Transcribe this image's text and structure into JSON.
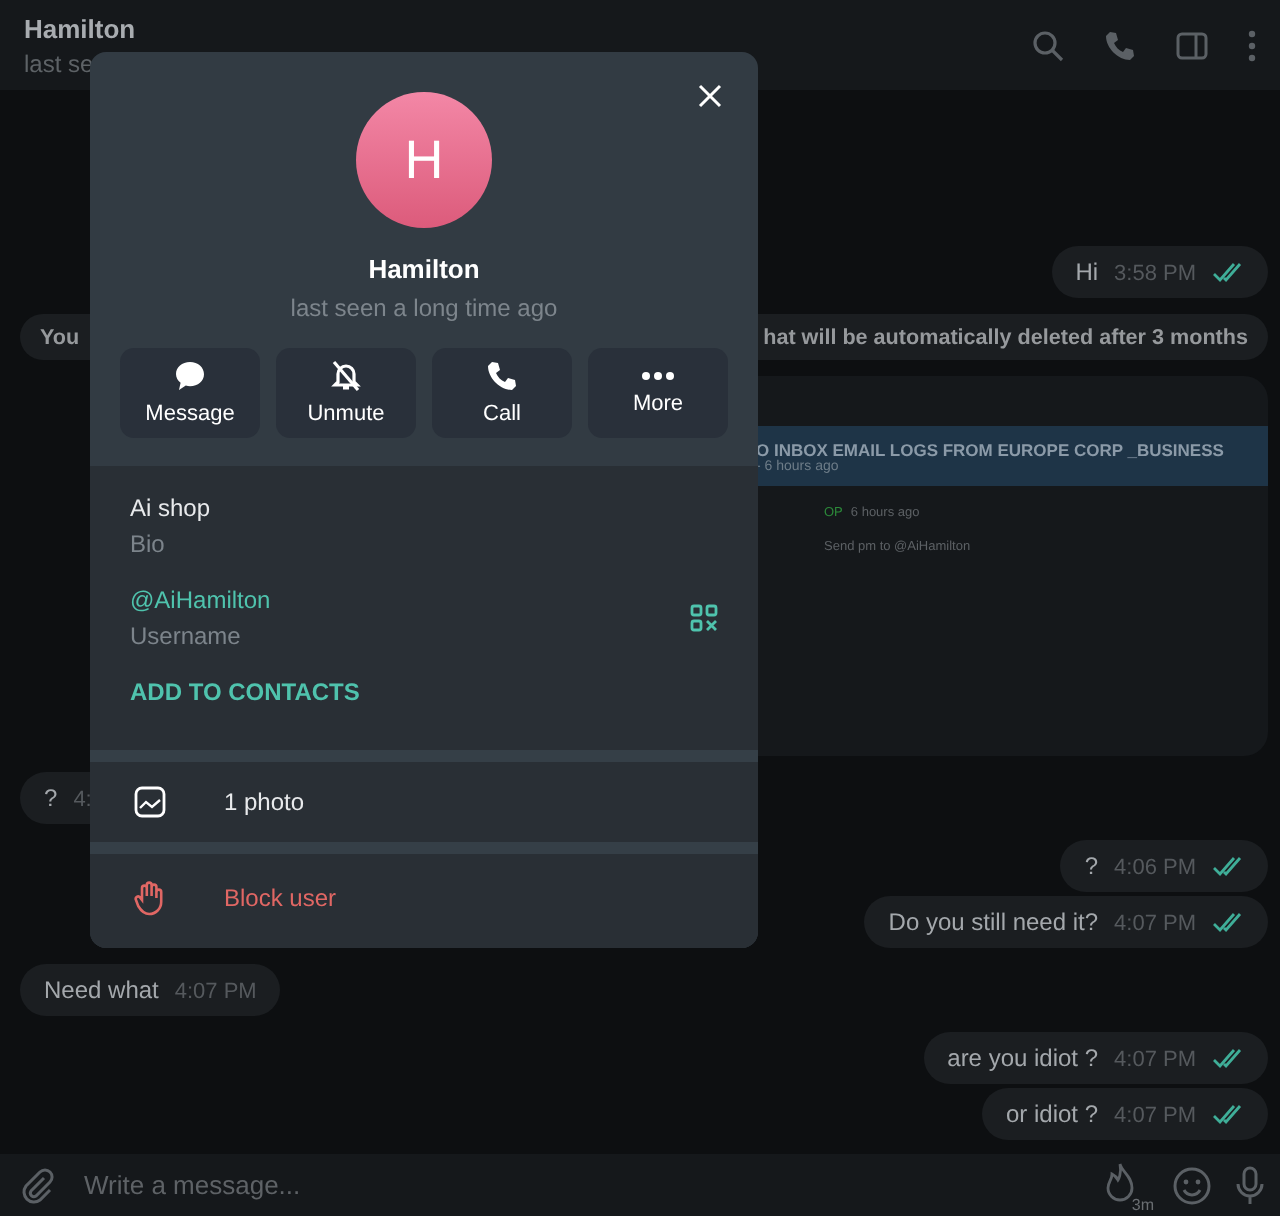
{
  "header": {
    "title": "Hamilton",
    "status": "last se"
  },
  "messages": [
    {
      "kind": "out",
      "text": "Hi",
      "time": "3:58 PM"
    },
    {
      "kind": "service",
      "text_start": "You",
      "text_end": "hat will be automatically deleted after 3 months"
    },
    {
      "kind": "preview",
      "title": "O INBOX EMAIL LOGS FROM EUROPE CORP _BUSINESS",
      "subtitle": "- 6 hours ago",
      "tag": "OP",
      "tag_time": "6 hours ago",
      "body": "Send pm to @AiHamilton"
    },
    {
      "kind": "in",
      "text": "?",
      "time": "4:"
    },
    {
      "kind": "out",
      "text": "?",
      "time": "4:06 PM"
    },
    {
      "kind": "out",
      "text": "Do you still need it?",
      "time": "4:07 PM"
    },
    {
      "kind": "in",
      "text": "Need what",
      "time": "4:07 PM"
    },
    {
      "kind": "out",
      "text": "are you idiot ?",
      "time": "4:07 PM"
    },
    {
      "kind": "out",
      "text": "or idiot ?",
      "time": "4:07 PM"
    }
  ],
  "composer": {
    "placeholder": "Write a message...",
    "timer": "3m"
  },
  "profile": {
    "initial": "H",
    "name": "Hamilton",
    "status": "last seen a long time ago",
    "actions": [
      {
        "kind": "message",
        "label": "Message"
      },
      {
        "kind": "unmute",
        "label": "Unmute"
      },
      {
        "kind": "call",
        "label": "Call"
      },
      {
        "kind": "more",
        "label": "More"
      }
    ],
    "info": [
      {
        "kind": "bio",
        "value": "Ai shop",
        "label": "Bio"
      },
      {
        "kind": "username",
        "value": "@AiHamilton",
        "label": "Username"
      }
    ],
    "add_contact": "ADD TO CONTACTS",
    "media": "1 photo",
    "block": "Block user"
  }
}
